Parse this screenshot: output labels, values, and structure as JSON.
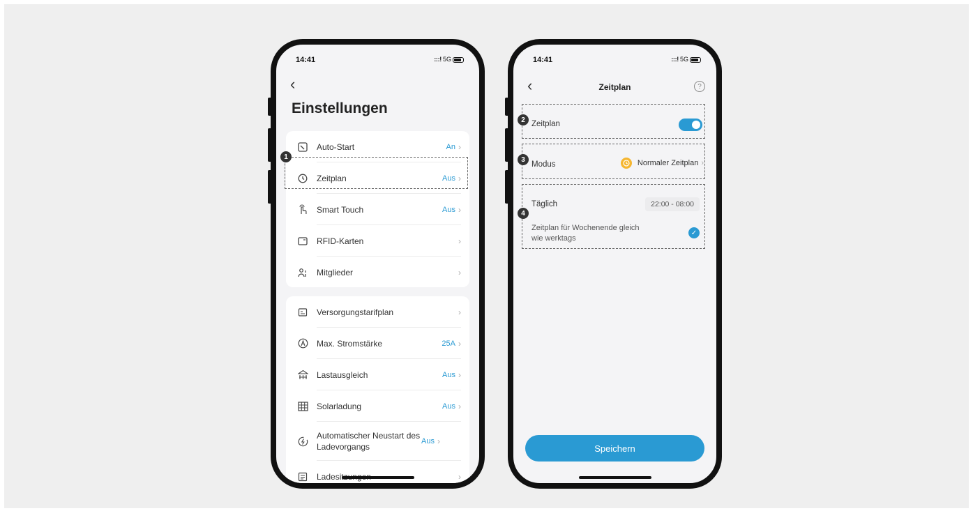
{
  "status": {
    "time": "14:41",
    "signal": ":::!",
    "network": "5G"
  },
  "settings": {
    "title": "Einstellungen",
    "group1": [
      {
        "label": "Auto-Start",
        "value": "An",
        "icon": "auto-start-icon"
      },
      {
        "label": "Zeitplan",
        "value": "Aus",
        "icon": "clock-icon"
      },
      {
        "label": "Smart Touch",
        "value": "Aus",
        "icon": "touch-hand-icon"
      },
      {
        "label": "RFID-Karten",
        "value": "",
        "icon": "rfid-card-icon"
      },
      {
        "label": "Mitglieder",
        "value": "",
        "icon": "members-icon"
      }
    ],
    "group2": [
      {
        "label": "Versorgungstarifplan",
        "value": "",
        "icon": "tariff-icon"
      },
      {
        "label": "Max. Stromstärke",
        "value": "25A",
        "icon": "ampere-icon"
      },
      {
        "label": "Lastausgleich",
        "value": "Aus",
        "icon": "load-balance-icon"
      },
      {
        "label": "Solarladung",
        "value": "Aus",
        "icon": "solar-panel-icon"
      },
      {
        "label": "Automatischer Neustart des Ladevorgangs",
        "value": "Aus",
        "icon": "restart-charging-icon"
      },
      {
        "label": "Ladesitzungen",
        "value": "",
        "icon": "sessions-icon"
      }
    ],
    "badge": "1"
  },
  "schedule": {
    "header": "Zeitplan",
    "toggle_label": "Zeitplan",
    "toggle_on": true,
    "mode_label": "Modus",
    "mode_value": "Normaler Zeitplan",
    "daily_label": "Täglich",
    "daily_time": "22:00 - 08:00",
    "weekend_line1": "Zeitplan für Wochenende gleich",
    "weekend_line2": "wie werktags",
    "save_label": "Speichern",
    "badges": [
      "2",
      "3",
      "4"
    ]
  },
  "colors": {
    "accent": "#2a9ad3",
    "mode_icon": "#f5b631",
    "background": "#efefef"
  }
}
